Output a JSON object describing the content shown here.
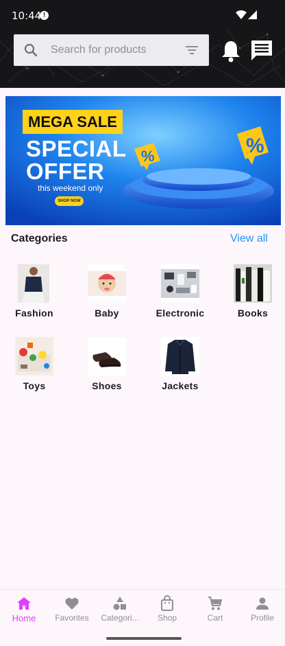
{
  "status_bar": {
    "time": "10:44"
  },
  "header": {
    "search": {
      "placeholder": "Search for products",
      "value": ""
    },
    "icons": [
      "search-icon",
      "filter-icon",
      "bell-icon",
      "chat-icon"
    ]
  },
  "banner": {
    "tag": "MEGA SALE",
    "title_line1": "SPECIAL",
    "title_line2": "OFFER",
    "subtitle": "this weekend only",
    "cta": "SHOP NOW",
    "badge_symbol": "%",
    "colors": {
      "background": "#1a6fe0",
      "tag": "#ffd21a"
    }
  },
  "categories": {
    "title": "Categories",
    "view_all": "View all",
    "items": [
      {
        "label": "Fashion"
      },
      {
        "label": "Baby"
      },
      {
        "label": "Electronic"
      },
      {
        "label": "Books"
      },
      {
        "label": "Toys"
      },
      {
        "label": "Shoes"
      },
      {
        "label": "Jackets"
      }
    ]
  },
  "bottom_nav": {
    "active_color": "#e040fb",
    "items": [
      {
        "label": "Home",
        "icon": "home-icon",
        "active": true
      },
      {
        "label": "Favorites",
        "icon": "heart-icon",
        "active": false
      },
      {
        "label": "Categori...",
        "icon": "shapes-icon",
        "active": false
      },
      {
        "label": "Shop",
        "icon": "shopping-bag-icon",
        "active": false
      },
      {
        "label": "Cart",
        "icon": "cart-icon",
        "active": false
      },
      {
        "label": "Profile",
        "icon": "person-icon",
        "active": false
      }
    ]
  }
}
